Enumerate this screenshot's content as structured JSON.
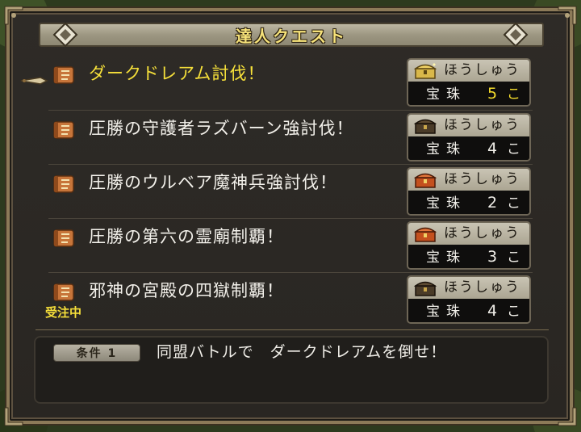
{
  "window": {
    "title": "達人クエスト"
  },
  "colors": {
    "frame_gold": "#8c7a58",
    "active_yellow": "#f6e03a",
    "panel_bg": "#2b2824",
    "reward_header": "#bdb7a3"
  },
  "quests": [
    {
      "name": "ダークドレアム討伐！",
      "active": true,
      "reward_label": "ほうしゅう",
      "reward_item": "宝珠",
      "reward_count": "5",
      "reward_unit": "こ",
      "chest_icon": "gold-chest-icon"
    },
    {
      "name": "圧勝の守護者ラズバーン強討伐！",
      "active": false,
      "reward_label": "ほうしゅう",
      "reward_item": "宝珠",
      "reward_count": "4",
      "reward_unit": "こ",
      "chest_icon": "dark-chest-icon"
    },
    {
      "name": "圧勝のウルベア魔神兵強討伐！",
      "active": false,
      "reward_label": "ほうしゅう",
      "reward_item": "宝珠",
      "reward_count": "2",
      "reward_unit": "こ",
      "chest_icon": "red-chest-icon"
    },
    {
      "name": "圧勝の第六の霊廟制覇！",
      "active": false,
      "reward_label": "ほうしゅう",
      "reward_item": "宝珠",
      "reward_count": "3",
      "reward_unit": "こ",
      "chest_icon": "red-chest-icon"
    },
    {
      "name": "邪神の宮殿の四獄制覇！",
      "active": false,
      "status": "受注中",
      "reward_label": "ほうしゅう",
      "reward_item": "宝珠",
      "reward_count": "4",
      "reward_unit": "こ",
      "chest_icon": "dark-chest-icon"
    }
  ],
  "condition": {
    "badge": "条件 1",
    "text": "同盟バトルで　ダークドレアムを倒せ！"
  },
  "icons": {
    "scroll": "quest-scroll-icon",
    "cursor": "pointer-hand-icon",
    "title_ornament": "diamond-ornament-icon"
  }
}
